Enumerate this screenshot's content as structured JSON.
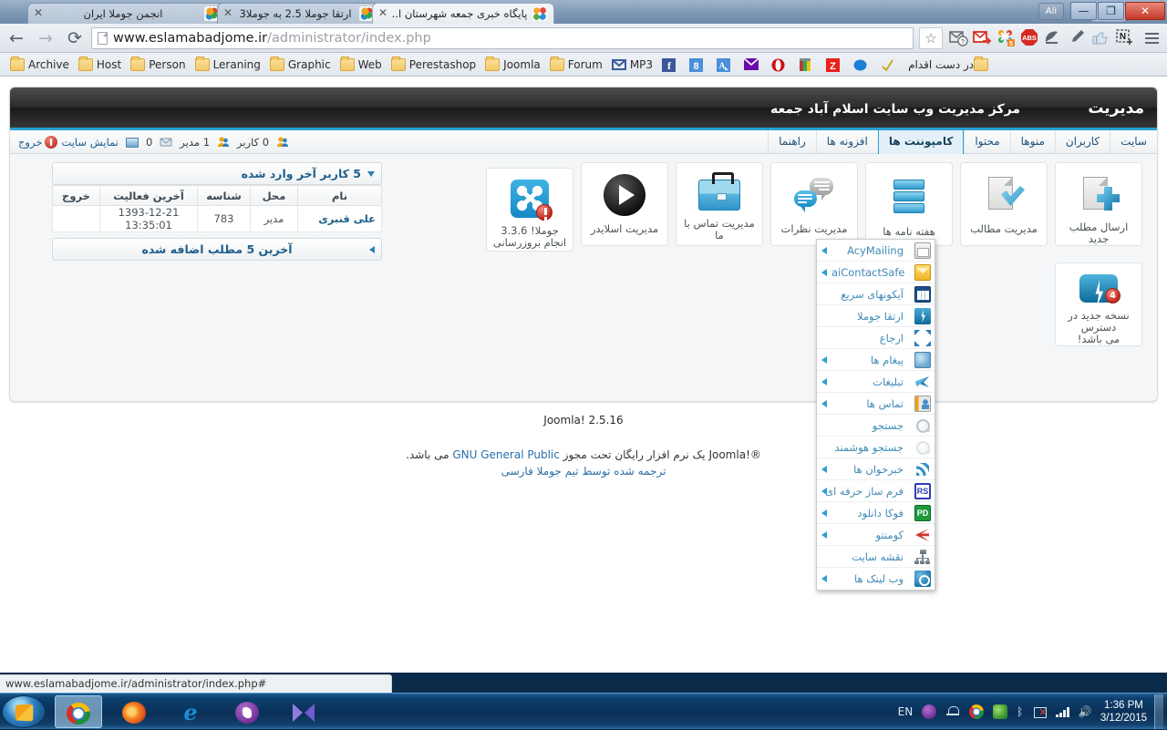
{
  "browser": {
    "tabs": [
      {
        "title": "انجمن جوملا ایران",
        "favicon": "joomla-icon",
        "active": false
      },
      {
        "title": "ارتقا جوملا 2.5 به جوملا3",
        "favicon": "joomla-icon",
        "active": false
      },
      {
        "title": "پایگاه خبری جمعه شهرستان ا..",
        "favicon": "joomla-blue-icon",
        "active": true
      }
    ],
    "close_glyph": "✕",
    "nav": {
      "back": "←",
      "forward": "→",
      "reload": "⟳"
    },
    "url_display": {
      "host": "www.eslamabadjome.ir",
      "path": "/administrator/index.php"
    },
    "star_glyph": "☆",
    "extensions": [
      {
        "name": "gmail-checker-icon",
        "label": "M"
      },
      {
        "name": "gmail-icon",
        "label": "M"
      },
      {
        "name": "joomla-extension-icon",
        "label": "J"
      },
      {
        "name": "adblock-icon",
        "label": "ABS"
      },
      {
        "name": "satellite-icon",
        "label": ""
      },
      {
        "name": "eyedropper-icon",
        "label": ""
      },
      {
        "name": "thumbs-up-icon",
        "label": ""
      },
      {
        "name": "evernote-icon",
        "label": "N"
      }
    ],
    "window_controls": {
      "ali": "Ali",
      "minimize": "—",
      "restore": "❐",
      "close": "✕"
    }
  },
  "bookmarks": [
    {
      "label": "Archive",
      "icon": "folder-icon"
    },
    {
      "label": "Host",
      "icon": "folder-icon"
    },
    {
      "label": "Person",
      "icon": "folder-icon"
    },
    {
      "label": "Leraning",
      "icon": "folder-icon"
    },
    {
      "label": "Graphic",
      "icon": "folder-icon"
    },
    {
      "label": "Web",
      "icon": "folder-icon"
    },
    {
      "label": "Perestashop",
      "icon": "folder-icon"
    },
    {
      "label": "Joomla",
      "icon": "folder-icon"
    },
    {
      "label": "Forum",
      "icon": "folder-icon"
    },
    {
      "label": "MP3",
      "icon": "gmail-icon"
    },
    {
      "label": "",
      "icon": "facebook-icon"
    },
    {
      "label": "",
      "icon": "google-icon"
    },
    {
      "label": "",
      "icon": "translate-icon"
    },
    {
      "label": "",
      "icon": "mail-icon"
    },
    {
      "label": "",
      "icon": "opera-icon"
    },
    {
      "label": "",
      "icon": "paint-icon"
    },
    {
      "label": "",
      "icon": "zoomit-icon"
    },
    {
      "label": "",
      "icon": "blue-dot-icon"
    },
    {
      "label": "",
      "icon": "checkmark-icon"
    },
    {
      "label": "در دست اقدام",
      "icon": "folder-icon"
    }
  ],
  "admin": {
    "logo_title": "مدیریت",
    "site_description": "مرکز مدیریت وب سایت اسلام آباد جمعه",
    "menu": [
      {
        "label": "سایت",
        "active": false
      },
      {
        "label": "کاربران",
        "active": false
      },
      {
        "label": "منوها",
        "active": false
      },
      {
        "label": "محتوا",
        "active": false
      },
      {
        "label": "کامپوننت ها",
        "active": true
      },
      {
        "label": "افزونه ها",
        "active": false
      },
      {
        "label": "راهنما",
        "active": false
      }
    ],
    "userbar": {
      "visitors": "0 کاربر",
      "admins": "1 مدیر",
      "messages": "0",
      "preview": "نمایش سایت",
      "logout": "خروج"
    }
  },
  "dropdown": {
    "items": [
      {
        "label": "AcyMailing",
        "icon": "mail-open-icon",
        "submenu": true,
        "latin": true
      },
      {
        "label": "aiContactSafe",
        "icon": "envelope-icon",
        "submenu": true,
        "latin": true
      },
      {
        "label": "آیکونهای سریع",
        "icon": "grid-icon",
        "submenu": false,
        "latin": false
      },
      {
        "label": "ارتقا جوملا",
        "icon": "bolt-icon",
        "submenu": false,
        "latin": false
      },
      {
        "label": "ارجاع",
        "icon": "arrows-icon",
        "submenu": false,
        "latin": false
      },
      {
        "label": "پیغام ها",
        "icon": "cloud-mail-icon",
        "submenu": true,
        "latin": false
      },
      {
        "label": "تبلیغات",
        "icon": "banner-icon",
        "submenu": true,
        "latin": false
      },
      {
        "label": "تماس ها",
        "icon": "contact-card-icon",
        "submenu": true,
        "latin": false
      },
      {
        "label": "جستجو",
        "icon": "search-icon",
        "submenu": false,
        "latin": false
      },
      {
        "label": "جستجو هوشمند",
        "icon": "smart-search-icon",
        "submenu": false,
        "latin": false
      },
      {
        "label": "خبرخوان ها",
        "icon": "rss-icon",
        "submenu": true,
        "latin": false
      },
      {
        "label": "فرم ساز حرفه ای",
        "icon": "rsform-icon",
        "submenu": true,
        "latin": false
      },
      {
        "label": "فوکا دانلود",
        "icon": "phocadownload-icon",
        "submenu": true,
        "latin": false
      },
      {
        "label": "کومنتو",
        "icon": "komento-icon",
        "submenu": true,
        "latin": false
      },
      {
        "label": "نقشه سایت",
        "icon": "sitemap-icon",
        "submenu": false,
        "latin": false
      },
      {
        "label": "وب لینک ها",
        "icon": "weblink-icon",
        "submenu": true,
        "latin": false
      }
    ]
  },
  "cpanel": {
    "quick_icons": [
      {
        "label": "ارسال مطلب جدید",
        "icon": "doc-plus-icon"
      },
      {
        "label": "مدیریت مطالب",
        "icon": "doc-check-icon"
      },
      {
        "label": "هفته نامه ها",
        "icon": "database-icon"
      },
      {
        "label": "مدیریت نظرات",
        "icon": "comments-icon"
      },
      {
        "label": "مدیریت تماس با ما",
        "icon": "briefcase-icon"
      },
      {
        "label": "مدیریت اسلایدر",
        "icon": "play-icon"
      }
    ],
    "status_icons": [
      {
        "label": "جوملا! 3.3.6\nانجام بروزرسانی",
        "line1": "جوملا! 3.3.6",
        "line2": "انجام بروزرسانی",
        "icon": "joomla-update-icon",
        "badge": "!"
      },
      {
        "label": "نسخه جدید در دسترس می باشد!",
        "line1": "نسخه جدید در دسترس",
        "line2": "می باشد!",
        "icon": "extension-update-icon",
        "badge": "4"
      }
    ],
    "last_users_module": {
      "title": "5 کاربر آخر وارد شده",
      "columns": [
        "نام",
        "محل",
        "شناسه",
        "آخرین فعالیت",
        "خروج"
      ],
      "rows": [
        {
          "name": "علی قنبری",
          "place": "مدیر",
          "id": "783",
          "last_activity": "1393-12-21 13:35:01",
          "logout": ""
        }
      ]
    },
    "last_articles_module": {
      "title": "آخرین 5 مطلب اضافه شده"
    }
  },
  "footer": {
    "version": "Joomla! 2.5.16",
    "license_pre": "®!Joomla یک نرم افزار رایگان تحت مجوز ",
    "license_link": "GNU General Public",
    "license_post": " می باشد.",
    "translation": "ترجمه شده توسط تیم جوملا فارسی"
  },
  "statusbar": {
    "url": "www.eslamabadjome.ir/administrator/index.php#"
  },
  "taskbar": {
    "start": "start-orb",
    "apps": [
      {
        "name": "chrome",
        "active": true
      },
      {
        "name": "firefox",
        "active": false
      },
      {
        "name": "internet-explorer",
        "active": false
      },
      {
        "name": "viber",
        "active": false
      },
      {
        "name": "bow",
        "active": false
      }
    ],
    "tray": {
      "language": "EN",
      "time": "1:36 PM",
      "date": "3/12/2015"
    }
  }
}
